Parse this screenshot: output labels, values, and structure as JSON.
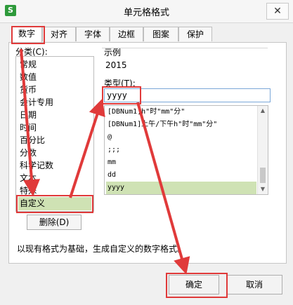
{
  "window": {
    "title": "单元格格式",
    "close_glyph": "✕",
    "app_icon_text": "S"
  },
  "tabs": [
    "数字",
    "对齐",
    "字体",
    "边框",
    "图案",
    "保护"
  ],
  "category": {
    "label": "分类(C):",
    "items": [
      "常规",
      "数值",
      "货币",
      "会计专用",
      "日期",
      "时间",
      "百分比",
      "分数",
      "科学记数",
      "文本",
      "特殊",
      "自定义"
    ],
    "selected": "自定义"
  },
  "sample": {
    "label": "示例",
    "value": "2015"
  },
  "type": {
    "label": "类型(T):",
    "value": "yyyy",
    "formats": [
      "[DBNum1]h\"时\"mm\"分\"",
      "[DBNum1]上午/下午h\"时\"mm\"分\"",
      "@",
      ";;;",
      "mm",
      "dd",
      "yyyy"
    ],
    "selected": "yyyy"
  },
  "buttons": {
    "delete": "删除(D)",
    "ok": "确定",
    "cancel": "取消"
  },
  "description": "以现有格式为基础，生成自定义的数字格式。",
  "icons": {
    "app": "spreadsheet-icon",
    "close": "close-icon",
    "scroll_up": "chevron-up-icon",
    "scroll_down": "chevron-down-icon"
  },
  "colors": {
    "annotation": "#e03a3a",
    "selection": "#cfe2b4",
    "app_icon": "#2e9a3b"
  }
}
